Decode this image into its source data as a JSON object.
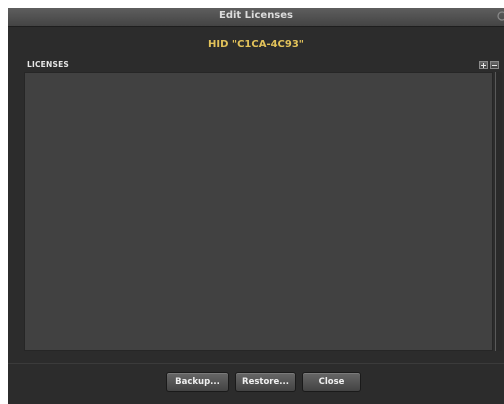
{
  "window": {
    "title": "Edit Licenses"
  },
  "hid": {
    "label": "HID \"C1CA-4C93\""
  },
  "licenses": {
    "section_label": "LICENSES",
    "items": []
  },
  "buttons": {
    "backup_label": "Backup...",
    "restore_label": "Restore...",
    "close_label": "Close"
  },
  "colors": {
    "window_bg": "#2c2c2c",
    "list_bg": "#414141",
    "hid_accent": "#e2c25a",
    "titlebar": "#4f4f4f"
  }
}
